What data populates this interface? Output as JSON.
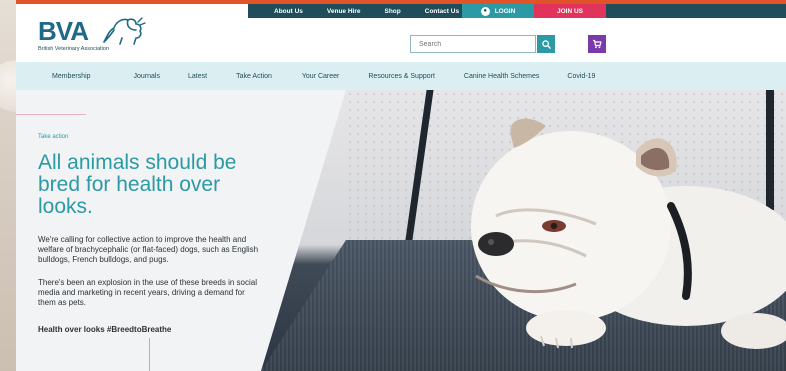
{
  "top_links": [
    "About Us",
    "Venue Hire",
    "Shop",
    "Contact Us"
  ],
  "login_label": "LOGIN",
  "join_label": "JOIN US",
  "logo": {
    "text": "BVA",
    "subtitle": "British Veterinary Association"
  },
  "search": {
    "placeholder": "Search"
  },
  "nav": [
    "Membership",
    "Journals",
    "Latest",
    "Take Action",
    "Your Career",
    "Resources & Support",
    "Canine Health Schemes",
    "Covid-19"
  ],
  "hero": {
    "tag": "Take action",
    "headline": "All animals should be bred for health over looks.",
    "paragraph1": "We're calling for collective action to improve the health and welfare of brachycephalic (or flat-faced) dogs, such as English bulldogs, French bulldogs, and pugs.",
    "paragraph2": "There's been an explosion in the use of these breeds in social media and marketing in recent years, driving a demand for them as pets.",
    "hashtag": "Health over looks #BreedtoBreathe"
  },
  "colors": {
    "teal": "#2b9aa5",
    "dark_teal": "#1f4e5a",
    "pink": "#e2335d",
    "purple": "#7a3aa8",
    "orange": "#e1542a",
    "nav_bg": "#dbeef1"
  }
}
